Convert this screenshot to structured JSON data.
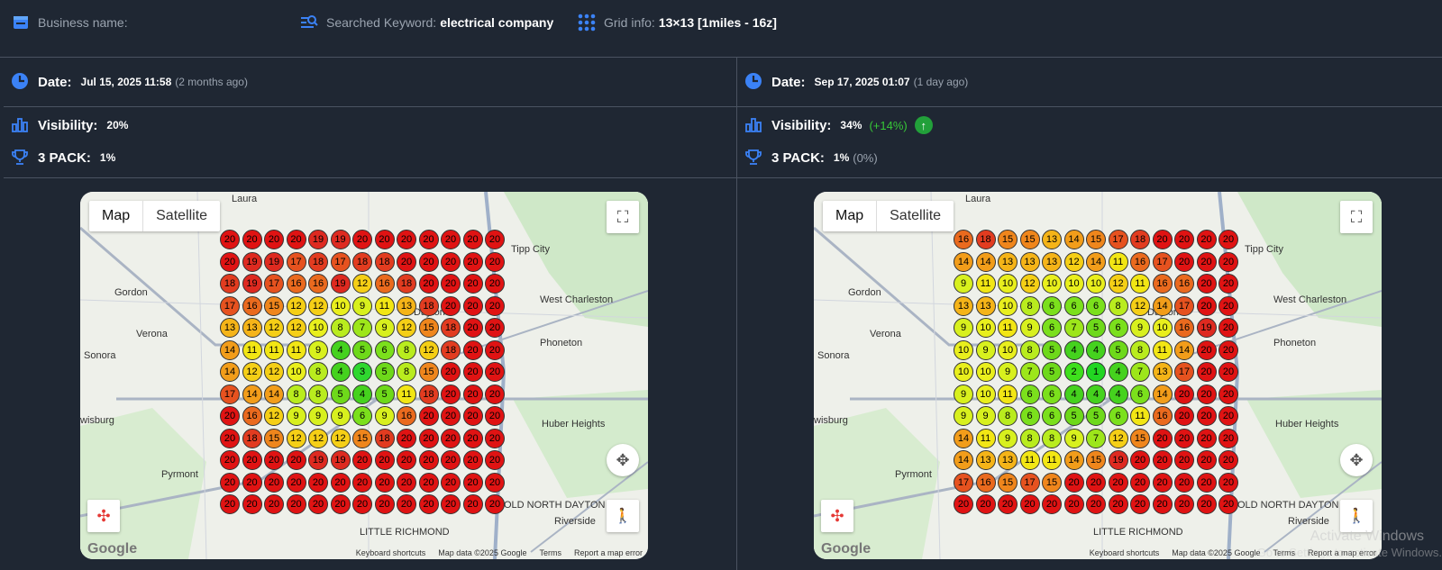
{
  "header": {
    "business_label": "Business name:",
    "keyword_label": "Searched Keyword:",
    "keyword_value": "electrical company",
    "grid_label": "Grid info:",
    "grid_value": "13×13 [1miles - 16z]"
  },
  "left": {
    "date_label": "Date:",
    "date_value": "Jul 15, 2025 11:58",
    "date_ago": "(2 months ago)",
    "visibility_label": "Visibility:",
    "visibility_value": "20%",
    "pack_label": "3 PACK:",
    "pack_value": "1%",
    "grid": [
      [
        20,
        20,
        20,
        20,
        19,
        19,
        20,
        20,
        20,
        20,
        20,
        20,
        20
      ],
      [
        20,
        19,
        19,
        17,
        18,
        17,
        18,
        18,
        20,
        20,
        20,
        20,
        20
      ],
      [
        18,
        19,
        17,
        16,
        16,
        19,
        12,
        16,
        18,
        20,
        20,
        20,
        20
      ],
      [
        17,
        16,
        15,
        12,
        12,
        10,
        9,
        11,
        13,
        18,
        20,
        20,
        20
      ],
      [
        13,
        13,
        12,
        12,
        10,
        8,
        7,
        9,
        12,
        15,
        18,
        20,
        20
      ],
      [
        14,
        11,
        11,
        11,
        9,
        4,
        5,
        6,
        8,
        12,
        18,
        20,
        20
      ],
      [
        14,
        12,
        12,
        10,
        8,
        4,
        3,
        5,
        8,
        15,
        20,
        20,
        20
      ],
      [
        17,
        14,
        14,
        8,
        8,
        5,
        4,
        5,
        11,
        18,
        20,
        20,
        20
      ],
      [
        20,
        16,
        12,
        9,
        9,
        9,
        6,
        9,
        16,
        20,
        20,
        20,
        20
      ],
      [
        20,
        18,
        15,
        12,
        12,
        12,
        15,
        18,
        20,
        20,
        20,
        20,
        20
      ],
      [
        20,
        20,
        20,
        20,
        19,
        19,
        20,
        20,
        20,
        20,
        20,
        20,
        20
      ],
      [
        20,
        20,
        20,
        20,
        20,
        20,
        20,
        20,
        20,
        20,
        20,
        20,
        20
      ],
      [
        20,
        20,
        20,
        20,
        20,
        20,
        20,
        20,
        20,
        20,
        20,
        20,
        20
      ]
    ]
  },
  "right": {
    "date_label": "Date:",
    "date_value": "Sep 17, 2025 01:07",
    "date_ago": "(1 day ago)",
    "visibility_label": "Visibility:",
    "visibility_value": "34%",
    "visibility_delta": "(+14%)",
    "pack_label": "3 PACK:",
    "pack_value": "1%",
    "pack_delta": "(0%)",
    "grid": [
      [
        16,
        18,
        15,
        15,
        13,
        14,
        15,
        17,
        18,
        20,
        20,
        20,
        20
      ],
      [
        14,
        14,
        13,
        13,
        13,
        12,
        14,
        11,
        16,
        17,
        20,
        20,
        20
      ],
      [
        9,
        11,
        10,
        12,
        10,
        10,
        10,
        12,
        11,
        16,
        16,
        20,
        20
      ],
      [
        13,
        13,
        10,
        8,
        6,
        6,
        6,
        8,
        12,
        14,
        17,
        20,
        20
      ],
      [
        9,
        10,
        11,
        9,
        6,
        7,
        5,
        6,
        9,
        10,
        16,
        19,
        20
      ],
      [
        10,
        9,
        10,
        8,
        5,
        4,
        4,
        5,
        8,
        11,
        14,
        20,
        20
      ],
      [
        10,
        10,
        9,
        7,
        5,
        2,
        1,
        4,
        7,
        13,
        17,
        20,
        20
      ],
      [
        9,
        10,
        11,
        6,
        6,
        4,
        4,
        4,
        6,
        14,
        20,
        20,
        20
      ],
      [
        9,
        9,
        8,
        6,
        6,
        5,
        5,
        6,
        11,
        16,
        20,
        20,
        20
      ],
      [
        14,
        11,
        9,
        8,
        8,
        9,
        7,
        12,
        15,
        20,
        20,
        20,
        20
      ],
      [
        14,
        13,
        13,
        11,
        11,
        14,
        15,
        19,
        20,
        20,
        20,
        20,
        20
      ],
      [
        17,
        16,
        15,
        17,
        15,
        20,
        20,
        20,
        20,
        20,
        20,
        20,
        20
      ],
      [
        20,
        20,
        20,
        20,
        20,
        20,
        20,
        20,
        20,
        20,
        20,
        20,
        20
      ]
    ]
  },
  "map": {
    "map_btn": "Map",
    "satellite_btn": "Satellite",
    "places": [
      "Laura",
      "Gordon",
      "Verona",
      "Sonora",
      "Pyrmont",
      "Tipp City",
      "West Charleston",
      "Phoneton",
      "Huber Heights",
      "Riverside",
      "wisburg",
      "Dayton",
      "LITTLE RICHMOND",
      "OLD NORTH DAYTON"
    ],
    "footer_shortcuts": "Keyboard shortcuts",
    "footer_data": "Map data ©2025 Google",
    "footer_terms": "Terms",
    "footer_report": "Report a map error",
    "google": "Google"
  },
  "watermark": {
    "line1": "Activate Windows",
    "line2": "Go to Settings to activate Windows."
  }
}
